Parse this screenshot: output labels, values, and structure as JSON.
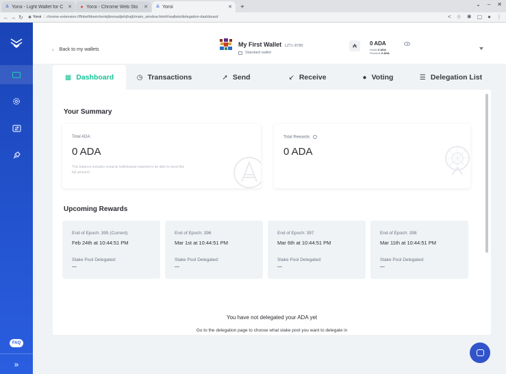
{
  "browser": {
    "tabs": [
      {
        "label": "Yoroi - Light Wallet for C",
        "active": false
      },
      {
        "label": "Yoroi - Chrome Web Sto",
        "active": false
      },
      {
        "label": "Yoroi",
        "active": true
      }
    ],
    "new_tab": "+",
    "site_label": "Yoroi",
    "url": "chrome-extension://ffnbelfdoeiohenkjibnmadjiehjhajb/main_window.html#/wallets/delegation-dashboard"
  },
  "sidebar": {
    "faq_label": "FAQ",
    "expand_glyph": "»",
    "accent_color": "#17d1aa",
    "background": "#1a44b7"
  },
  "header": {
    "back_label": "Back to my wallets",
    "wallet_name": "My First Wallet",
    "wallet_plate": "LZTL-8780",
    "wallet_type": "Standard wallet",
    "ada_symbol": "₳",
    "balance": "0 ADA",
    "wallet_label": "Wallet",
    "wallet_value": "0 ADA",
    "rewards_label": "Rewards",
    "rewards_value": "0 ADA"
  },
  "tabs": [
    {
      "label": "Dashboard",
      "icon": "dashboard-icon",
      "active": true
    },
    {
      "label": "Transactions",
      "icon": "transactions-icon",
      "active": false
    },
    {
      "label": "Send",
      "icon": "send-icon",
      "active": false
    },
    {
      "label": "Receive",
      "icon": "receive-icon",
      "active": false
    },
    {
      "label": "Voting",
      "icon": "voting-icon",
      "active": false
    },
    {
      "label": "Delegation List",
      "icon": "list-icon",
      "active": false
    }
  ],
  "summary": {
    "title": "Your Summary",
    "total_ada_label": "Total ADA:",
    "total_ada_value": "0 ADA",
    "total_ada_note": "This balance includes rewards (withdrawal required to be able to send this full amount)",
    "total_rewards_label": "Total Rewards:",
    "total_rewards_value": "0 ADA"
  },
  "upcoming": {
    "title": "Upcoming Rewards",
    "cards": [
      {
        "epoch": "End of Epoch: 395 (Current)",
        "date": "Feb 24th at 10:44:51 PM",
        "pool_label": "Stake Pool Delegated:",
        "pool_value": "—"
      },
      {
        "epoch": "End of Epoch: 396",
        "date": "Mar 1st at 10:44:51 PM",
        "pool_label": "Stake Pool Delegated:",
        "pool_value": "—"
      },
      {
        "epoch": "End of Epoch: 397",
        "date": "Mar 6th at 10:44:51 PM",
        "pool_label": "Stake Pool Delegated:",
        "pool_value": "—"
      },
      {
        "epoch": "End of Epoch: 398",
        "date": "Mar 11th at 10:44:51 PM",
        "pool_label": "Stake Pool Delegated:",
        "pool_value": "—"
      }
    ]
  },
  "not_delegated": "You have not delegated your ADA yet",
  "go_to_delegation": "Go to the delegation page to choose what stake pool you want to delegate in",
  "colors": {
    "accent": "#17c297",
    "primary_blue": "#3154cb"
  }
}
